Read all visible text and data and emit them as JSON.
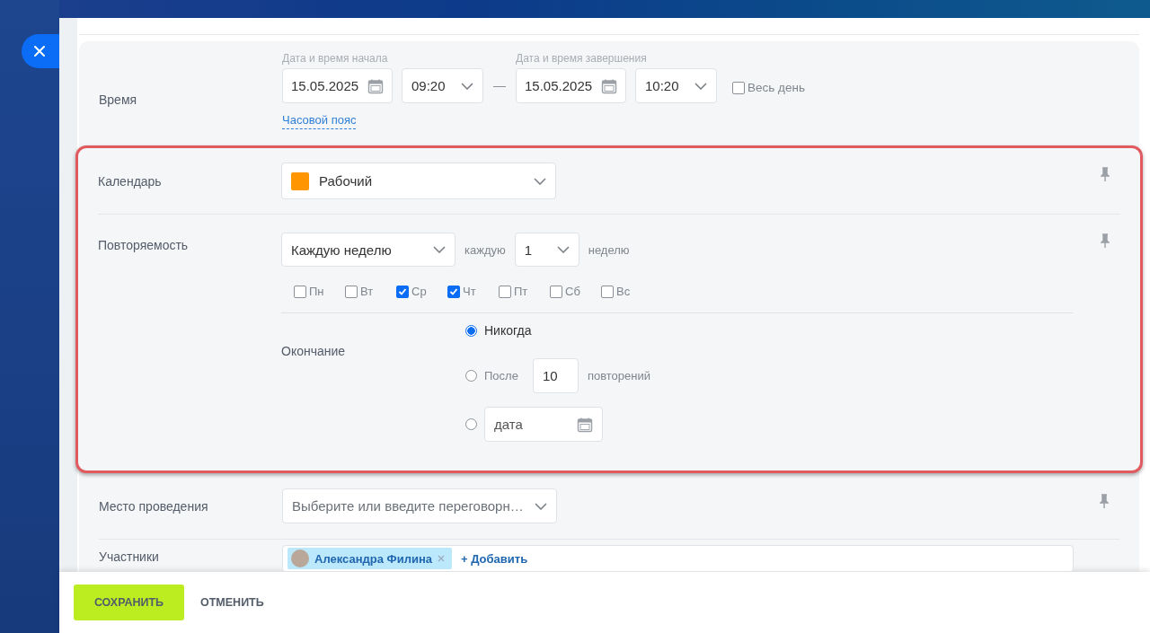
{
  "time": {
    "label": "Время",
    "start": {
      "caption": "Дата и время начала",
      "date": "15.05.2025",
      "time": "09:20"
    },
    "separator": "—",
    "end": {
      "caption": "Дата и время завершения",
      "date": "15.05.2025",
      "time": "10:20"
    },
    "all_day": {
      "label": "Весь день",
      "checked": false
    },
    "timezone_link": "Часовой пояс"
  },
  "calendar": {
    "label": "Календарь",
    "value": "Рабочий",
    "color": "#ff9500"
  },
  "recurrence": {
    "label": "Повторяемость",
    "frequency": "Каждую неделю",
    "every_label": "каждую",
    "interval": "1",
    "unit": "неделю",
    "days": [
      {
        "label": "Пн",
        "checked": false
      },
      {
        "label": "Вт",
        "checked": false
      },
      {
        "label": "Ср",
        "checked": true
      },
      {
        "label": "Чт",
        "checked": true
      },
      {
        "label": "Пт",
        "checked": false
      },
      {
        "label": "Сб",
        "checked": false
      },
      {
        "label": "Вс",
        "checked": false
      }
    ],
    "end": {
      "label": "Окончание",
      "options": [
        {
          "kind": "never",
          "label": "Никогда",
          "selected": true
        },
        {
          "kind": "count",
          "label": "После",
          "value": "10",
          "suffix": "повторений",
          "selected": false
        },
        {
          "kind": "date",
          "placeholder": "дата",
          "selected": false
        }
      ]
    }
  },
  "location": {
    "label": "Место проведения",
    "value": "Выберите или введите переговорн…"
  },
  "participants": {
    "label": "Участники",
    "people": [
      {
        "name": "Александра Филина"
      }
    ],
    "add_link": "+ Добавить"
  },
  "footer": {
    "buttons": [
      {
        "label": "СОХРАНИТЬ",
        "kind": "primary"
      },
      {
        "label": "ОТМЕНИТЬ",
        "kind": "secondary"
      }
    ]
  }
}
